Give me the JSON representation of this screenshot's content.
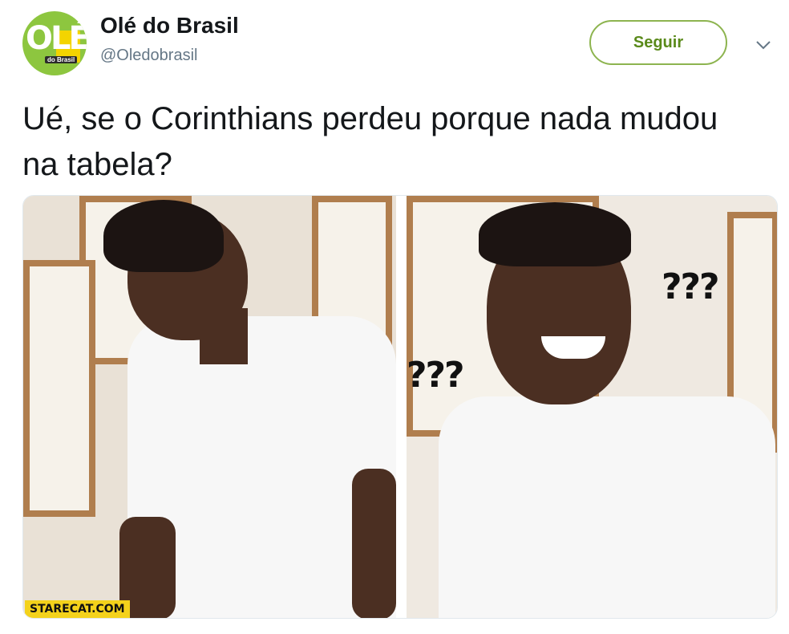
{
  "account": {
    "display_name": "Olé do Brasil",
    "handle": "@Oledobrasil",
    "avatar_text": "OLÉ",
    "avatar_sub": "do Brasil"
  },
  "actions": {
    "follow_label": "Seguir"
  },
  "tweet": {
    "text": "Ué, se o Corinthians perdeu porque nada mudou na tabela?"
  },
  "media": {
    "left_panel": {
      "watermark": "STARECAT.COM"
    },
    "right_panel": {
      "question_marks_1": "???",
      "question_marks_2": "???"
    }
  },
  "colors": {
    "accent": "#5a8a1a",
    "accent_border": "#8db44f",
    "text": "#14171a",
    "muted": "#657786"
  }
}
